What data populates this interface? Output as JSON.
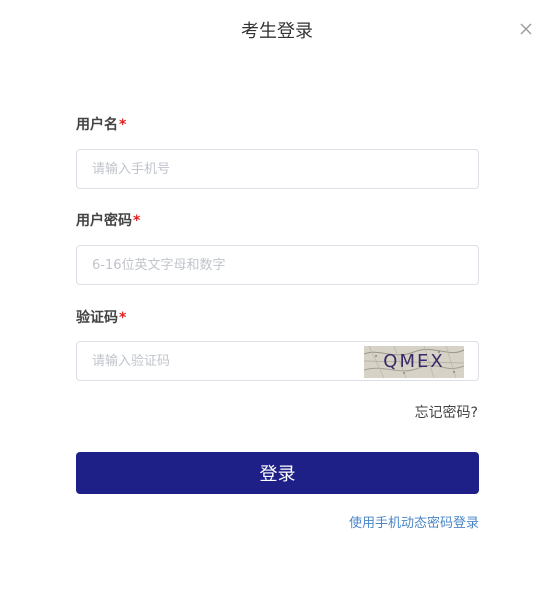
{
  "dialog": {
    "title": "考生登录"
  },
  "form": {
    "username": {
      "label": "用户名",
      "required_mark": "*",
      "placeholder": "请输入手机号",
      "value": ""
    },
    "password": {
      "label": "用户密码",
      "required_mark": "*",
      "placeholder": "6-16位英文字母和数字",
      "value": ""
    },
    "captcha": {
      "label": "验证码",
      "required_mark": "*",
      "placeholder": "请输入验证码",
      "value": "",
      "image_text": "QMEX"
    }
  },
  "links": {
    "forgot_password": "忘记密码?",
    "sms_login": "使用手机动态密码登录"
  },
  "buttons": {
    "login": "登录"
  },
  "colors": {
    "primary": "#1e2087",
    "link": "#4a86c8",
    "required": "#e02020",
    "border": "#dcdfe6"
  },
  "icons": {
    "close": "close-icon"
  }
}
